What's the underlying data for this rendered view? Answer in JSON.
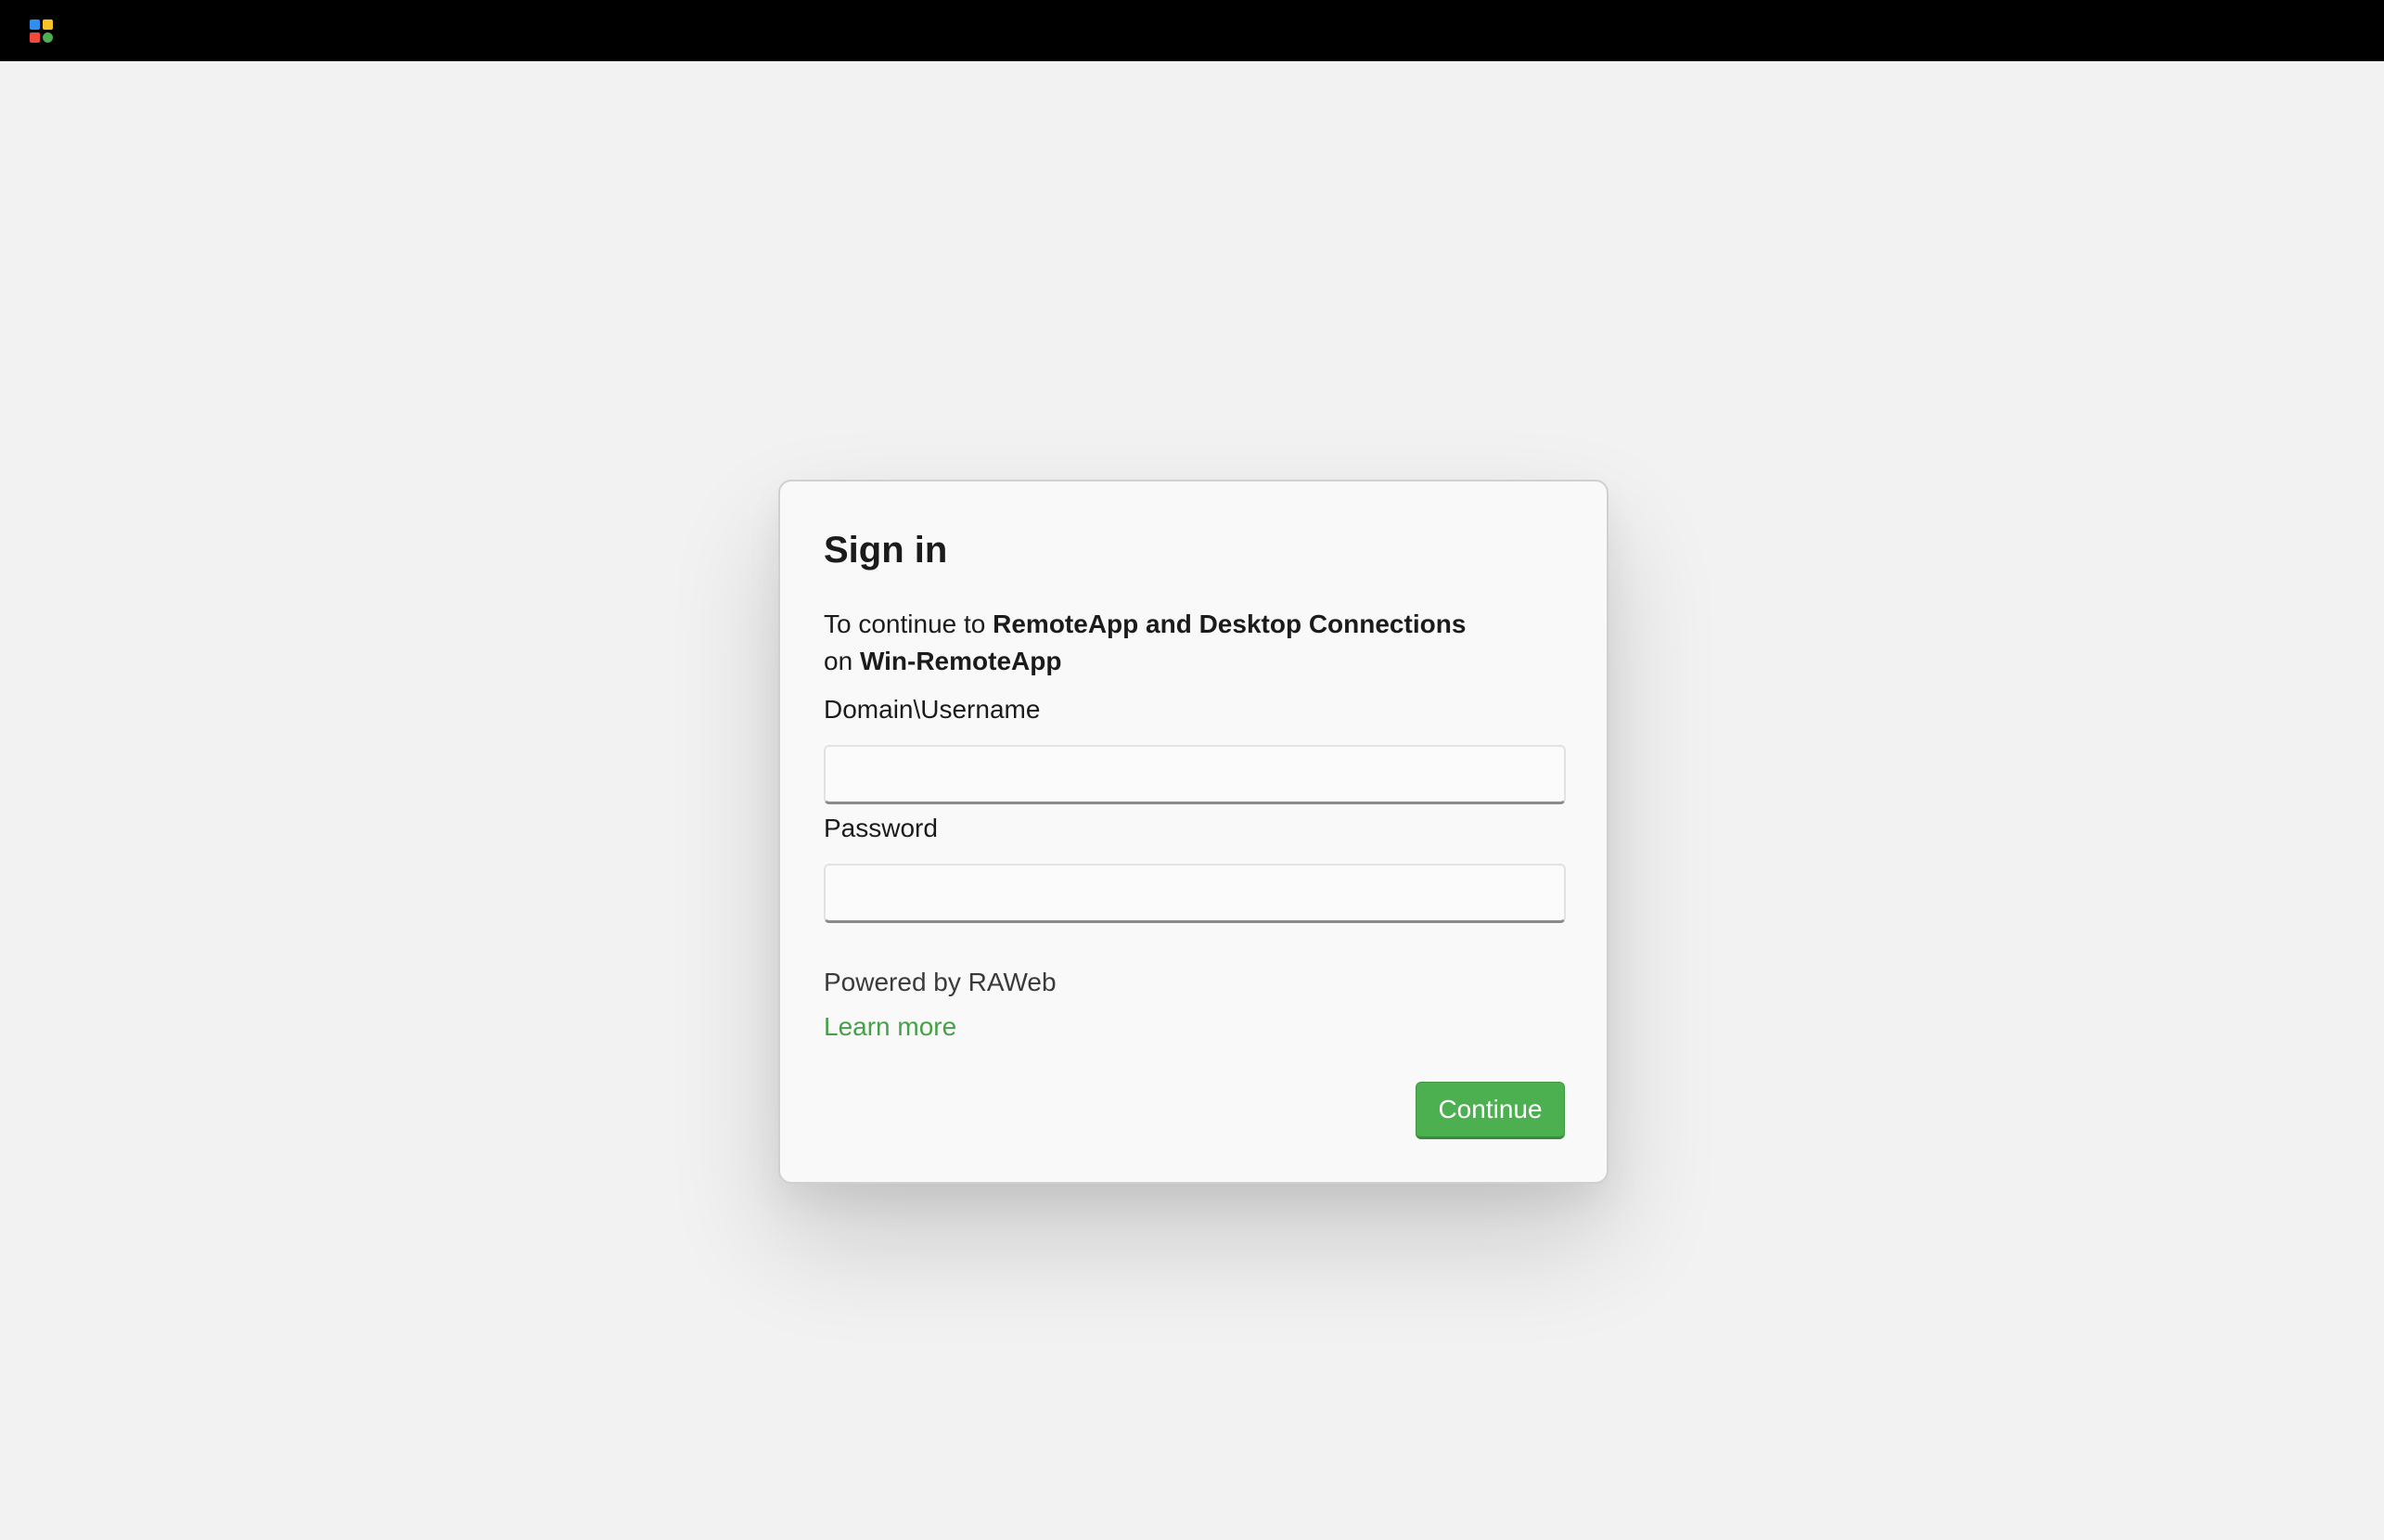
{
  "topbar": {
    "logo_icon": "app-grid-icon",
    "logo_colors": [
      "#2f8ff0",
      "#f7c325",
      "#ef4a3c",
      "#4caf50"
    ]
  },
  "signin": {
    "title": "Sign in",
    "desc_prefix": "To continue to ",
    "app_name": "RemoteApp and Desktop Connections",
    "desc_on": "on ",
    "server_name": "Win-RemoteApp",
    "username_label": "Domain\\Username",
    "username_value": "",
    "password_label": "Password",
    "password_value": "",
    "powered_by": "Powered by RAWeb",
    "learn_more": "Learn more",
    "continue_label": "Continue"
  },
  "colors": {
    "accent": "#4caf50",
    "link": "#46a049",
    "background": "#f2f2f2",
    "topbar": "#000000"
  }
}
